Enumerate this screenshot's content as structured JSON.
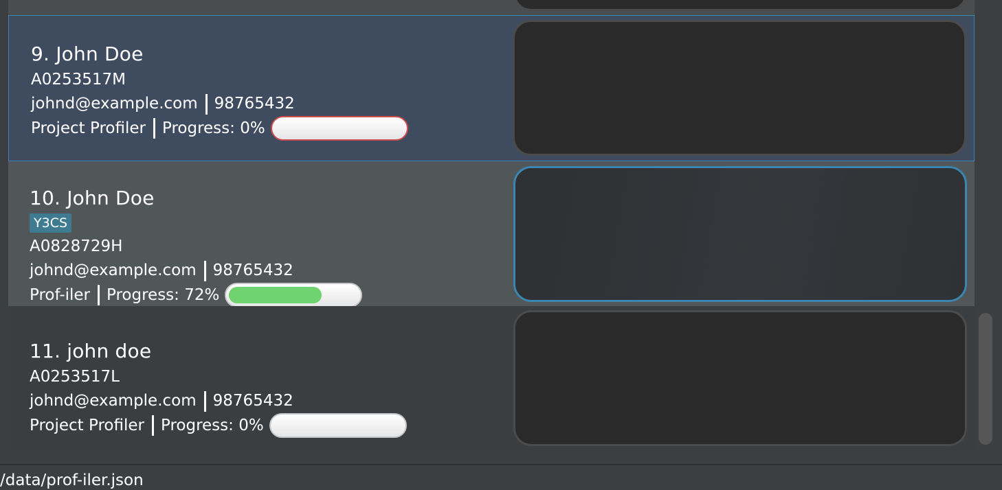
{
  "persons": [
    {
      "name": "9. John Doe",
      "tags": [],
      "student_id": "A0253517M",
      "email": "johnd@example.com",
      "phone": "98765432",
      "project": "Project Profiler",
      "progress_label": "Progress: 0%",
      "progress": 0,
      "selected": true
    },
    {
      "name": "10. John Doe",
      "tags": [
        "Y3CS"
      ],
      "student_id": "A0828729H",
      "email": "johnd@example.com",
      "phone": "98765432",
      "project": "Prof-iler",
      "progress_label": "Progress: 72%",
      "progress": 72,
      "selected": false
    },
    {
      "name": "11. john doe",
      "tags": [],
      "student_id": "A0253517L",
      "email": "johnd@example.com",
      "phone": "98765432",
      "project": "Project Profiler",
      "progress_label": "Progress: 0%",
      "progress": 0,
      "selected": false
    }
  ],
  "status_bar": {
    "file_path": "/data/prof-iler.json"
  },
  "colors": {
    "selected_border": "#3b86b0",
    "progress_fill": "#6fd36f",
    "tag_background": "#3e7b91",
    "empty_progress_border": "#cf4a4a"
  }
}
